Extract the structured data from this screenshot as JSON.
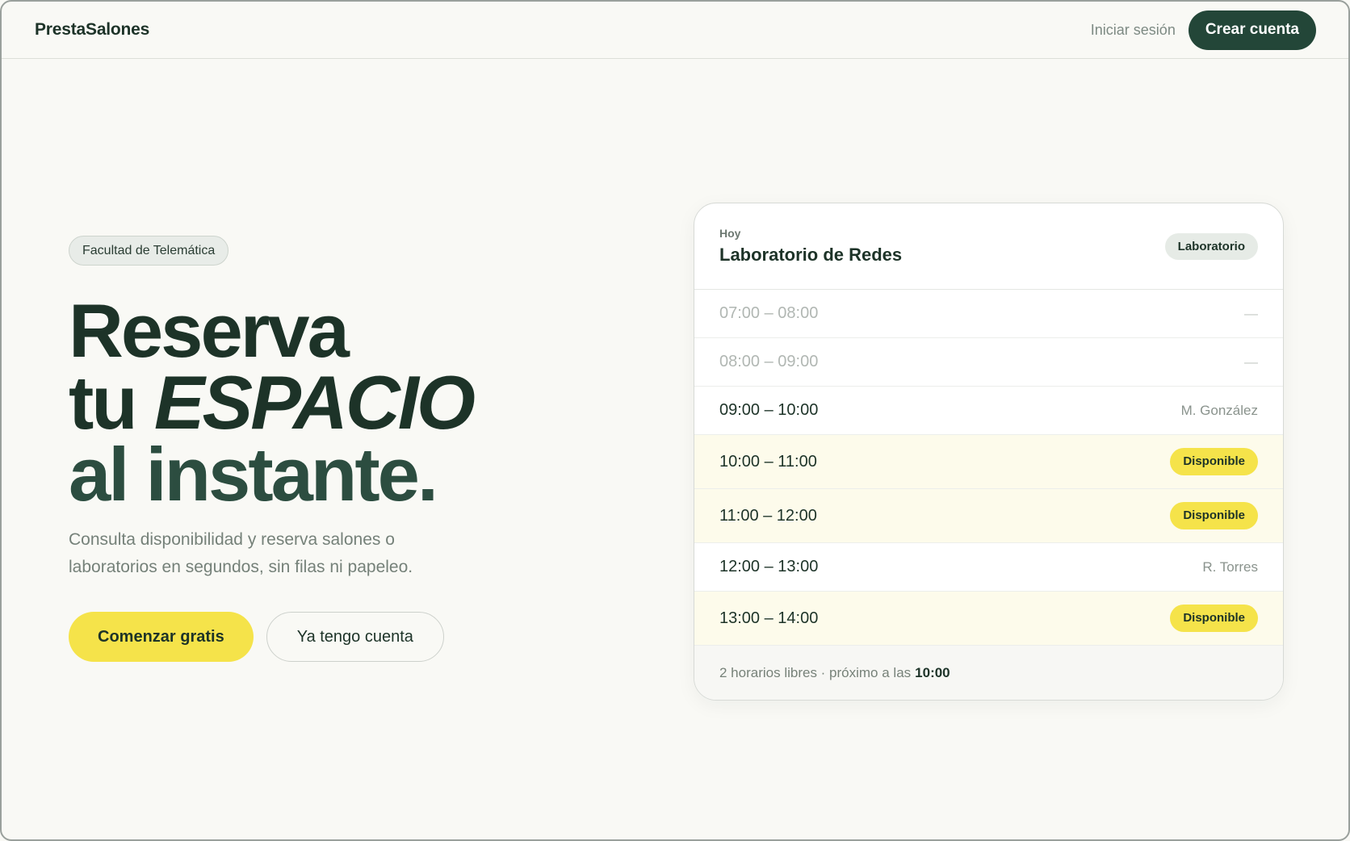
{
  "header": {
    "brand": "PrestaSalones",
    "login_label": "Iniciar sesión",
    "signup_label": "Crear cuenta"
  },
  "hero": {
    "tag": "Facultad de Telemática",
    "headline_line1": "Reserva",
    "headline_line2_prefix": "tu",
    "headline_line2_emphasis": "ESPACIO",
    "headline_line3": "al instante.",
    "subtitle": "Consulta disponibilidad y reserva salones o laboratorios en segundos, sin filas ni papeleo.",
    "primary_cta": "Comenzar gratis",
    "secondary_cta": "Ya tengo cuenta"
  },
  "schedule": {
    "eyebrow": "Hoy",
    "room_name": "Laboratorio de Redes",
    "room_type": "Laboratorio",
    "slots": [
      {
        "time": "07:00 – 08:00",
        "status": "past",
        "label": "—"
      },
      {
        "time": "08:00 – 09:00",
        "status": "past",
        "label": "—"
      },
      {
        "time": "09:00 – 10:00",
        "status": "booked",
        "label": "M. González"
      },
      {
        "time": "10:00 – 11:00",
        "status": "free",
        "label": "Disponible"
      },
      {
        "time": "11:00 – 12:00",
        "status": "free",
        "label": "Disponible"
      },
      {
        "time": "12:00 – 13:00",
        "status": "booked",
        "label": "R. Torres"
      },
      {
        "time": "13:00 – 14:00",
        "status": "free",
        "label": "Disponible"
      }
    ],
    "footer_text": "2 horarios libres · próximo a las",
    "footer_next_time": "10:00"
  },
  "colors": {
    "brand_dark": "#234638",
    "accent_yellow": "#f5e34a",
    "background": "#f9f9f5"
  }
}
